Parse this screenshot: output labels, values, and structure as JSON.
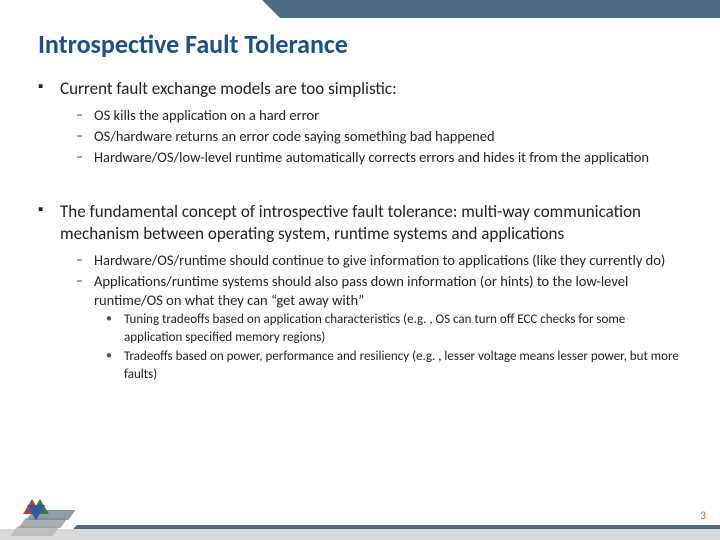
{
  "title": "Introspective Fault Tolerance",
  "page_number": "3",
  "accent_color": "#4a6b82",
  "title_color": "#1f4f83",
  "blocks": [
    {
      "text": "Current fault exchange models are too simplistic:",
      "subs": [
        {
          "text": "OS kills the application on a hard error"
        },
        {
          "text": "OS/hardware returns an error code saying something bad happened"
        },
        {
          "text": "Hardware/OS/low-level runtime automatically corrects errors and hides it from the application"
        }
      ]
    },
    {
      "text": "The fundamental concept of introspective fault tolerance: multi-way communication mechanism between operating system, runtime systems and applications",
      "subs": [
        {
          "text": "Hardware/OS/runtime should continue to give information to applications (like they currently do)"
        },
        {
          "text": "Applications/runtime systems should also pass down information (or hints)  to the low-level runtime/OS on what they can “get away with”",
          "subs": [
            {
              "text": "Tuning  tradeoffs based on application characteristics (e.g. , OS can turn off ECC checks for some application specified memory regions)"
            },
            {
              "text": "Tradeoffs based on power, performance and resiliency (e.g. , lesser voltage means lesser power, but more faults)"
            }
          ]
        }
      ]
    }
  ]
}
